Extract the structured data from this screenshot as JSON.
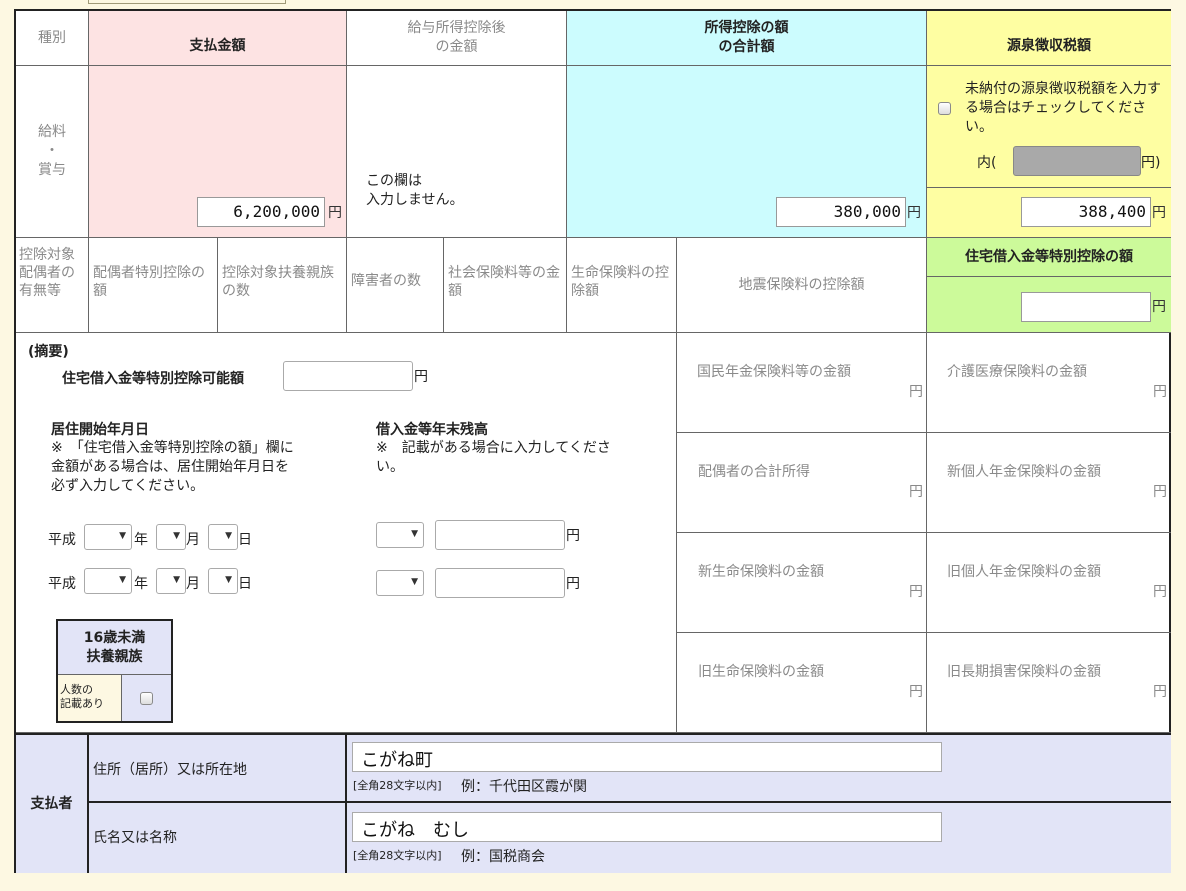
{
  "header": {
    "type_label": "種別",
    "payment": "支払金額",
    "after_deduction": "給与所得控除後\nの金額",
    "total_deduction": "所得控除の額\nの合計額",
    "withholding_tax": "源泉徴収税額"
  },
  "row1": {
    "type": "給料\n・\n賞与",
    "payment_value": "6,200,000",
    "payment_unit": "円",
    "no_input_note": "この欄は\n入力しません。",
    "deduction_value": "380,000",
    "deduction_unit": "円",
    "unpaid_note": "未納付の源泉徴収税額を入力する場合はチェックしてください。",
    "inner_prefix": "内(",
    "inner_suffix": "円)",
    "tax_value": "388,400",
    "tax_unit": "円"
  },
  "row2": {
    "spouse_flag": "控除対象配偶者の有無等",
    "spouse_deduction": "配偶者特別控除の額",
    "dependents": "控除対象扶養親族の数",
    "disabled": "障害者の数",
    "social_insurance": "社会保険料等の金額",
    "life_insurance": "生命保険料の控除額",
    "earthquake": "地震保険料の控除額",
    "housing_loan_header": "住宅借入金等特別控除の額",
    "housing_loan_unit": "円"
  },
  "summary": {
    "title": "(摘要)",
    "loan_possible": "住宅借入金等特別控除可能額",
    "loan_possible_unit": "円",
    "residence_start": "居住開始年月日",
    "residence_note": "※　「住宅借入金等特別控除の額」欄に\n金額がある場合は、居住開始年月日を\n必ず入力してください。",
    "era": "平成",
    "year": "年",
    "month": "月",
    "day": "日",
    "loan_balance": "借入金等年末残高",
    "loan_note": "※　記載がある場合に入力してくださ\nい。",
    "yen": "円",
    "under16_title": "16歳未満\n扶養親族",
    "under16_label": "人数の\n記載あり"
  },
  "right_fields": [
    {
      "label": "国民年金保険料等の金額",
      "unit": "円"
    },
    {
      "label": "介護医療保険料の金額",
      "unit": "円"
    },
    {
      "label": "配偶者の合計所得",
      "unit": "円"
    },
    {
      "label": "新個人年金保険料の金額",
      "unit": "円"
    },
    {
      "label": "新生命保険料の金額",
      "unit": "円"
    },
    {
      "label": "旧個人年金保険料の金額",
      "unit": "円"
    },
    {
      "label": "旧生命保険料の金額",
      "unit": "円"
    },
    {
      "label": "旧長期損害保険料の金額",
      "unit": "円"
    }
  ],
  "payer": {
    "title": "支払者",
    "address_label": "住所（居所）又は所在地",
    "address_value": "こがね町",
    "address_hint_limit": "[全角28文字以内]",
    "address_hint_example": "例：千代田区霞が関",
    "name_label": "氏名又は名称",
    "name_value": "こがね　むし",
    "name_hint_limit": "[全角28文字以内]",
    "name_hint_example": "例：国税商会"
  },
  "colors": {
    "payment_bg": "#fde3e3",
    "deduction_bg": "#ccfcfe",
    "tax_bg": "#fefea2",
    "housing_bg": "#ccfa9a",
    "payer_bg": "#e2e4f7"
  }
}
